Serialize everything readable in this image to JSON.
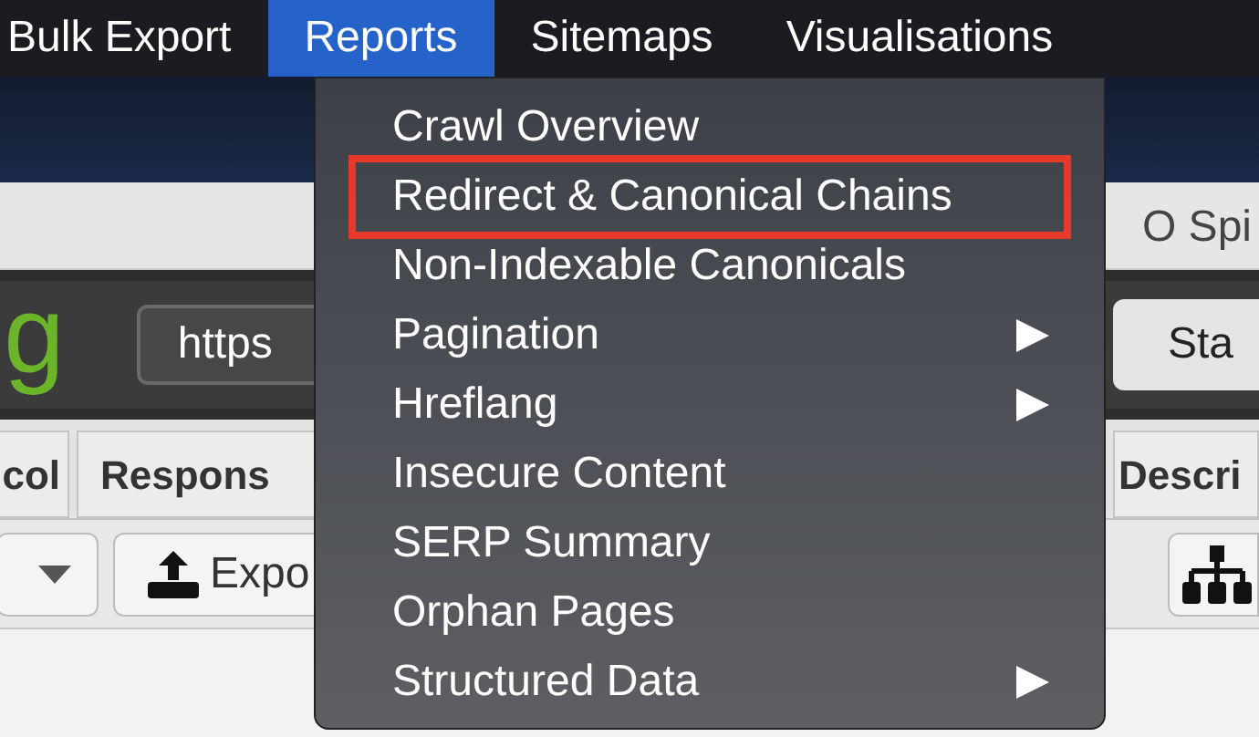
{
  "menu_bar": [
    {
      "label": "Bulk Export",
      "selected": false
    },
    {
      "label": "Reports",
      "selected": true
    },
    {
      "label": "Sitemaps",
      "selected": false
    },
    {
      "label": "Visualisations",
      "selected": false
    }
  ],
  "dropdown": {
    "items": [
      {
        "label": "Crawl Overview",
        "submenu": false,
        "highlighted": false
      },
      {
        "label": "Redirect & Canonical Chains",
        "submenu": false,
        "highlighted": true
      },
      {
        "label": "Non-Indexable Canonicals",
        "submenu": false,
        "highlighted": false
      },
      {
        "label": "Pagination",
        "submenu": true,
        "highlighted": false
      },
      {
        "label": "Hreflang",
        "submenu": true,
        "highlighted": false
      },
      {
        "label": "Insecure Content",
        "submenu": false,
        "highlighted": false
      },
      {
        "label": "SERP Summary",
        "submenu": false,
        "highlighted": false
      },
      {
        "label": "Orphan Pages",
        "submenu": false,
        "highlighted": false
      },
      {
        "label": "Structured Data",
        "submenu": true,
        "highlighted": false
      }
    ]
  },
  "app": {
    "window_title": "O Spi",
    "logo": "g",
    "url_field": {
      "value": "https"
    },
    "start_button": "Sta",
    "tabs": [
      {
        "label": "col"
      },
      {
        "label": "Respons"
      },
      {
        "label": "Descri"
      }
    ],
    "export_button": "Expo"
  }
}
